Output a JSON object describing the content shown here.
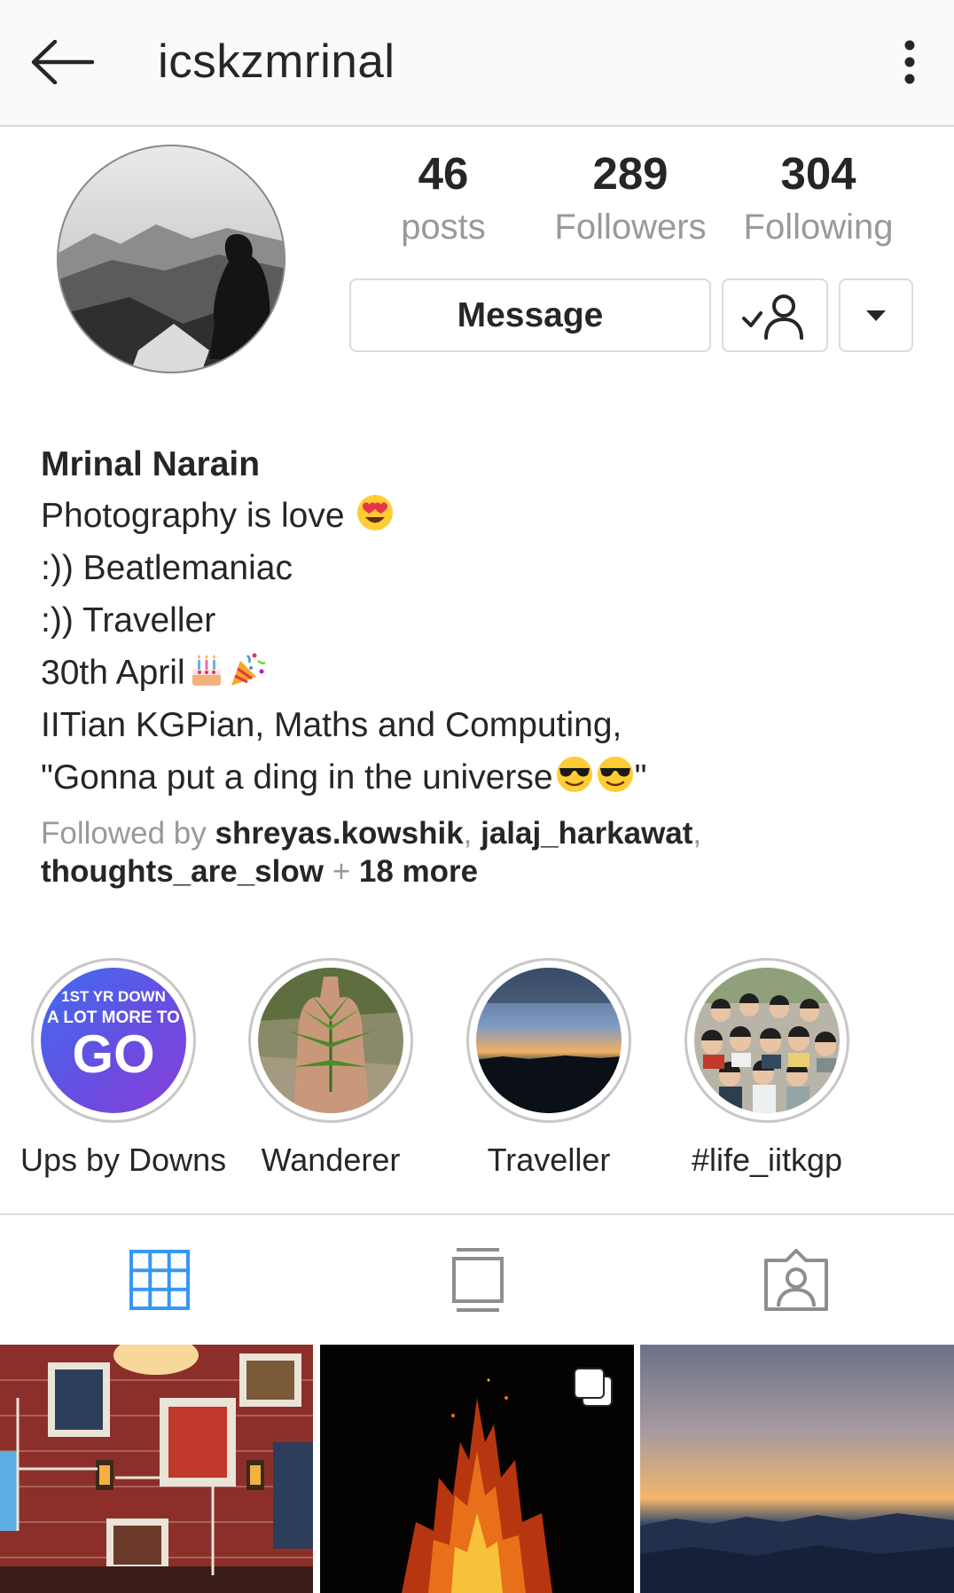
{
  "header": {
    "username": "icskzmrinal"
  },
  "stats": {
    "posts_count": "46",
    "posts_label": "posts",
    "followers_count": "289",
    "followers_label": "Followers",
    "following_count": "304",
    "following_label": "Following"
  },
  "actions": {
    "message_label": "Message"
  },
  "bio": {
    "full_name": "Mrinal Narain",
    "line1": "Photography is love",
    "line2": ":)) Beatlemaniac",
    "line3": ":)) Traveller",
    "line4": "30th April",
    "line5": "IITian KGPian, Maths and Computing,",
    "line6_start": "\"Gonna put a ding in the universe",
    "line6_end": "\""
  },
  "followed_by": {
    "prefix": "Followed by",
    "user1": "shreyas.kowshik",
    "user2": "jalaj_harkawat",
    "user3": "thoughts_are_slow",
    "plus": "+",
    "more": "18 more"
  },
  "highlights": [
    {
      "label": "Ups by Downs",
      "cover_text_top": "1ST YR DOWN",
      "cover_text_mid": "A LOT MORE TO",
      "cover_text_big": "GO"
    },
    {
      "label": "Wanderer"
    },
    {
      "label": "Traveller"
    },
    {
      "label": "#life_iitkgp"
    }
  ],
  "tabs": [
    {
      "name": "grid",
      "icon": "grid-icon",
      "active": true
    },
    {
      "name": "feed",
      "icon": "feed-icon",
      "active": false
    },
    {
      "name": "tagged",
      "icon": "tagged-icon",
      "active": false
    }
  ],
  "colors": {
    "active_tab": "#3897f0",
    "inactive_tab": "#8e8e8e",
    "muted_text": "#999999",
    "primary_text": "#262626",
    "border": "#dbdbdb"
  }
}
